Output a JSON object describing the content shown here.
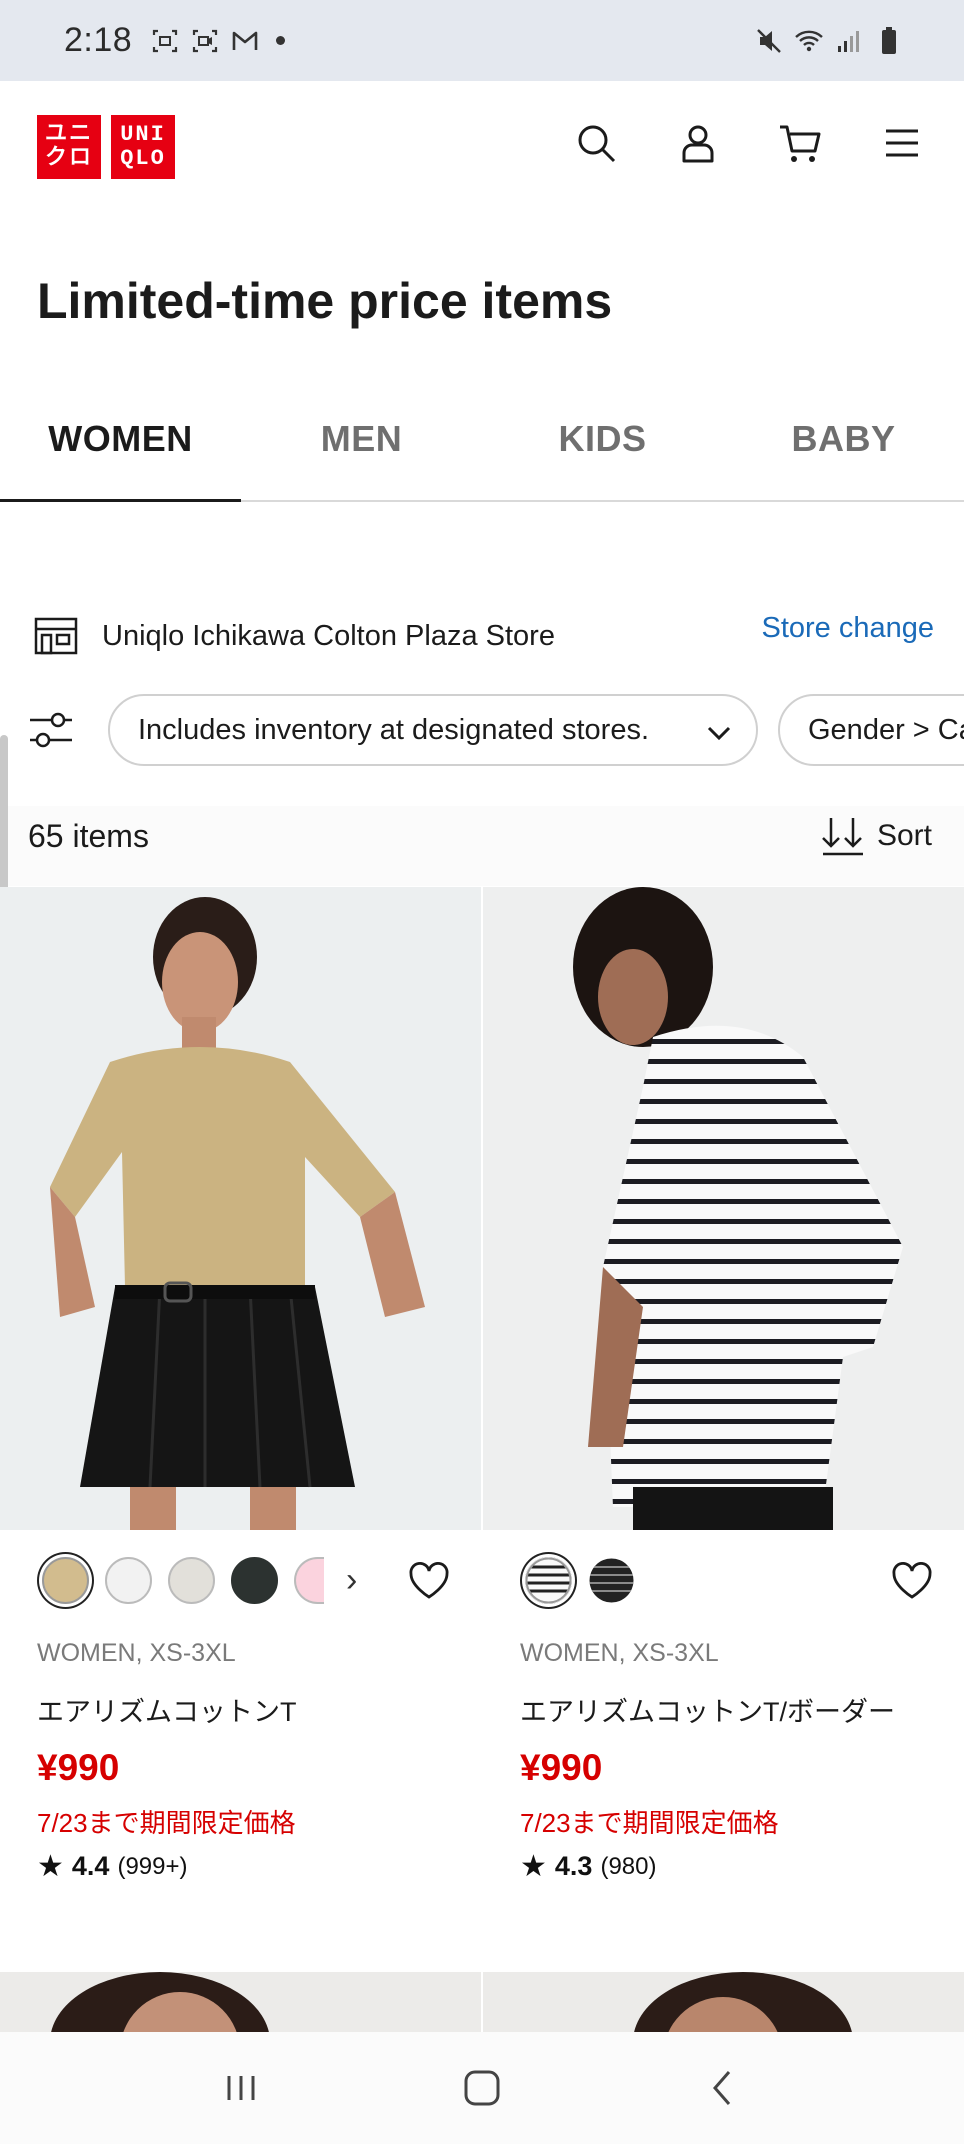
{
  "status_bar": {
    "time": "2:18",
    "left_icons": [
      "screenshot-icon",
      "screen-record-icon",
      "gmail-icon",
      "notification-dot"
    ],
    "right_icons": [
      "mute-icon",
      "wifi-icon",
      "signal-icon",
      "battery-icon"
    ]
  },
  "header": {
    "logo_left": [
      "ユニ",
      "クロ"
    ],
    "logo_right": [
      "UNI",
      "QLO"
    ],
    "icons": [
      "search-icon",
      "account-icon",
      "cart-icon",
      "menu-icon"
    ],
    "brand_color": "#e60012"
  },
  "page": {
    "title": "Limited-time price items"
  },
  "tabs": [
    {
      "label": "WOMEN",
      "active": true
    },
    {
      "label": "MEN",
      "active": false
    },
    {
      "label": "KIDS",
      "active": false
    },
    {
      "label": "BABY",
      "active": false
    }
  ],
  "store": {
    "name": "Uniqlo Ichikawa Colton Plaza Store",
    "change_label": "Store change",
    "link_color": "#1a6ab8"
  },
  "filters": {
    "pill1": "Includes inventory at designated stores.",
    "pill2": "Gender > Ca"
  },
  "results": {
    "count": "65 items",
    "sort_label": "Sort"
  },
  "products": [
    {
      "meta": "WOMEN, XS-3XL",
      "name": "エアリズムコットンT",
      "price": "¥990",
      "note": "7/23まで期間限定価格",
      "rating": "4.4",
      "reviews": "(999+)",
      "swatches": [
        "#d2bc8e",
        "#f2f2f2",
        "#e2e0da",
        "#2c3230",
        "#fbd3de"
      ]
    },
    {
      "meta": "WOMEN, XS-3XL",
      "name": "エアリズムコットンT/ボーダー",
      "price": "¥990",
      "note": "7/23まで期間限定価格",
      "rating": "4.3",
      "reviews": "(980)",
      "swatches": [
        "stripe-white",
        "stripe-black"
      ]
    }
  ],
  "price_color": "#d60000",
  "nav": {
    "icons": [
      "recent-apps-icon",
      "home-icon",
      "back-icon"
    ]
  }
}
